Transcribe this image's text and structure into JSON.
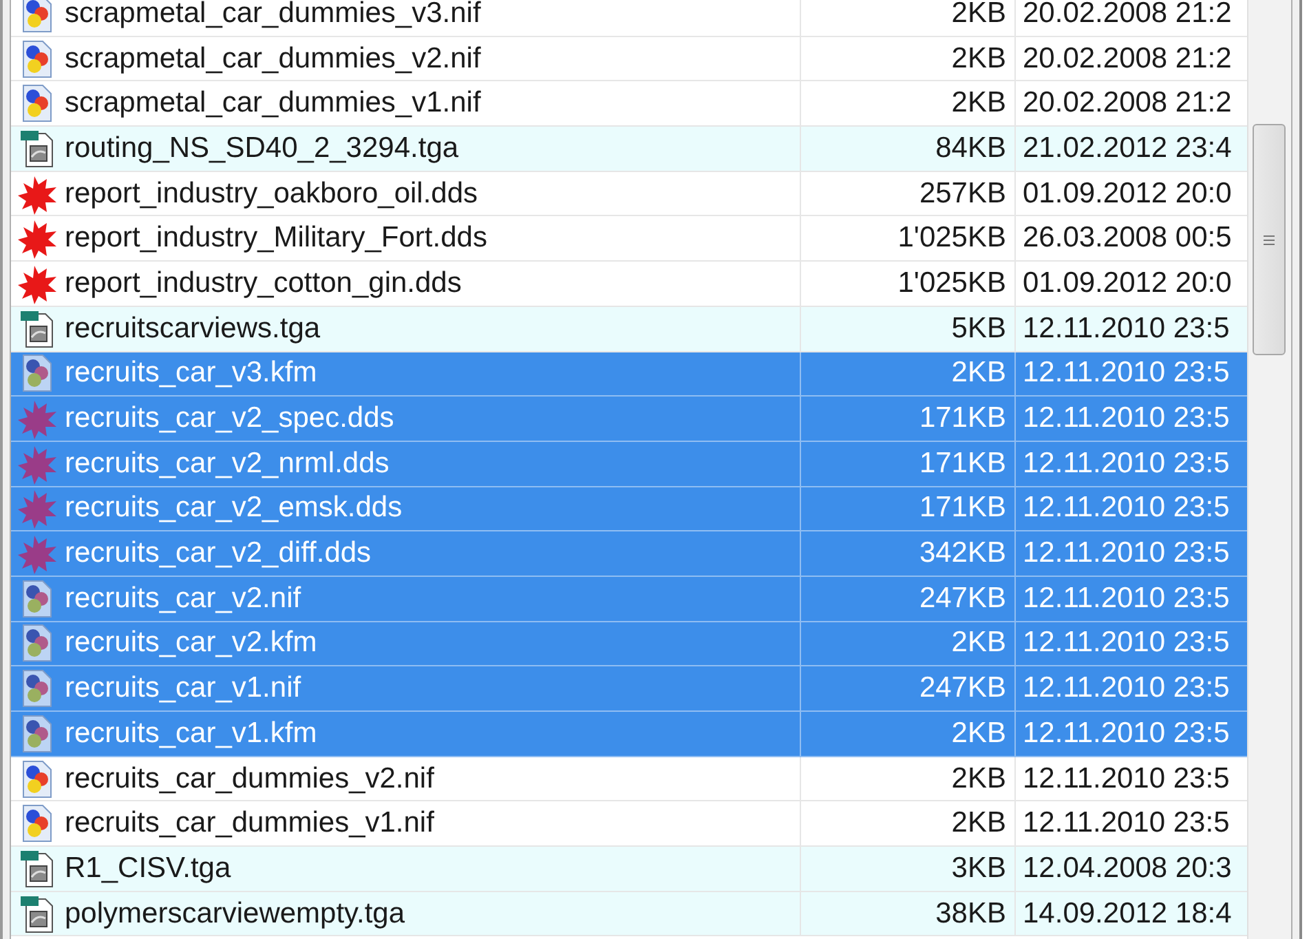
{
  "rows": [
    {
      "name": "scrapmetal_car_dummies_v3.nif",
      "size": "2KB",
      "date": "20.02.2008 21:2",
      "kind": "model",
      "selected": false,
      "highlighted": false
    },
    {
      "name": "scrapmetal_car_dummies_v2.nif",
      "size": "2KB",
      "date": "20.02.2008 21:2",
      "kind": "model",
      "selected": false,
      "highlighted": false
    },
    {
      "name": "scrapmetal_car_dummies_v1.nif",
      "size": "2KB",
      "date": "20.02.2008 21:2",
      "kind": "model",
      "selected": false,
      "highlighted": false
    },
    {
      "name": "routing_NS_SD40_2_3294.tga",
      "size": "84KB",
      "date": "21.02.2012 23:4",
      "kind": "image",
      "selected": false,
      "highlighted": true
    },
    {
      "name": "report_industry_oakboro_oil.dds",
      "size": "257KB",
      "date": "01.09.2012 20:0",
      "kind": "texture",
      "selected": false,
      "highlighted": false
    },
    {
      "name": "report_industry_Military_Fort.dds",
      "size": "1'025KB",
      "date": "26.03.2008 00:5",
      "kind": "texture",
      "selected": false,
      "highlighted": false
    },
    {
      "name": "report_industry_cotton_gin.dds",
      "size": "1'025KB",
      "date": "01.09.2012 20:0",
      "kind": "texture",
      "selected": false,
      "highlighted": false
    },
    {
      "name": "recruitscarviews.tga",
      "size": "5KB",
      "date": "12.11.2010 23:5",
      "kind": "image",
      "selected": false,
      "highlighted": true
    },
    {
      "name": "recruits_car_v3.kfm",
      "size": "2KB",
      "date": "12.11.2010 23:5",
      "kind": "model",
      "selected": true,
      "highlighted": false
    },
    {
      "name": "recruits_car_v2_spec.dds",
      "size": "171KB",
      "date": "12.11.2010 23:5",
      "kind": "texture",
      "selected": true,
      "highlighted": false
    },
    {
      "name": "recruits_car_v2_nrml.dds",
      "size": "171KB",
      "date": "12.11.2010 23:5",
      "kind": "texture",
      "selected": true,
      "highlighted": false
    },
    {
      "name": "recruits_car_v2_emsk.dds",
      "size": "171KB",
      "date": "12.11.2010 23:5",
      "kind": "texture",
      "selected": true,
      "highlighted": false
    },
    {
      "name": "recruits_car_v2_diff.dds",
      "size": "342KB",
      "date": "12.11.2010 23:5",
      "kind": "texture",
      "selected": true,
      "highlighted": false
    },
    {
      "name": "recruits_car_v2.nif",
      "size": "247KB",
      "date": "12.11.2010 23:5",
      "kind": "model",
      "selected": true,
      "highlighted": false
    },
    {
      "name": "recruits_car_v2.kfm",
      "size": "2KB",
      "date": "12.11.2010 23:5",
      "kind": "model",
      "selected": true,
      "highlighted": false
    },
    {
      "name": "recruits_car_v1.nif",
      "size": "247KB",
      "date": "12.11.2010 23:5",
      "kind": "model",
      "selected": true,
      "highlighted": false
    },
    {
      "name": "recruits_car_v1.kfm",
      "size": "2KB",
      "date": "12.11.2010 23:5",
      "kind": "model",
      "selected": true,
      "highlighted": false
    },
    {
      "name": "recruits_car_dummies_v2.nif",
      "size": "2KB",
      "date": "12.11.2010 23:5",
      "kind": "model",
      "selected": false,
      "highlighted": false
    },
    {
      "name": "recruits_car_dummies_v1.nif",
      "size": "2KB",
      "date": "12.11.2010 23:5",
      "kind": "model",
      "selected": false,
      "highlighted": false
    },
    {
      "name": "R1_CISV.tga",
      "size": "3KB",
      "date": "12.04.2008 20:3",
      "kind": "image",
      "selected": false,
      "highlighted": true
    },
    {
      "name": "polymerscarviewempty.tga",
      "size": "38KB",
      "date": "14.09.2012 18:4",
      "kind": "image",
      "selected": false,
      "highlighted": true
    }
  ]
}
